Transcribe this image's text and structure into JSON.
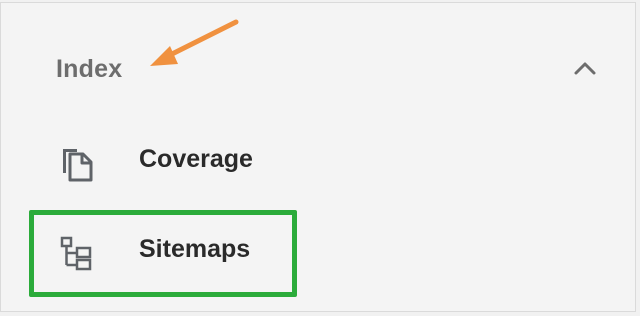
{
  "nav": {
    "section": {
      "title": "Index",
      "toggle_icon": "chevron-up-icon"
    },
    "items": [
      {
        "label": "Coverage",
        "icon": "pages-copy-icon",
        "highlighted": false
      },
      {
        "label": "Sitemaps",
        "icon": "sitemap-tree-icon",
        "highlighted": true
      }
    ]
  },
  "annotations": {
    "arrow_color": "#f0913f",
    "highlight_color": "#2bab3a"
  },
  "colors": {
    "background": "#f4f4f4",
    "section_title": "#6d6d6d",
    "item_label": "#2a2a2a",
    "icon": "#5f6368"
  }
}
